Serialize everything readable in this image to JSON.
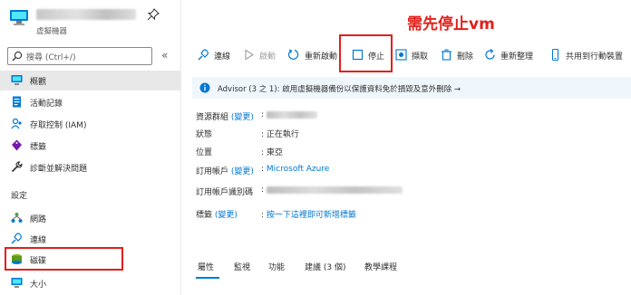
{
  "annotation": "需先停止vm",
  "vm": {
    "subtitle": "虛擬機器"
  },
  "search": {
    "placeholder": "搜尋 (Ctrl+/)"
  },
  "nav": {
    "items": [
      {
        "label": "概觀",
        "icon": "overview-icon"
      },
      {
        "label": "活動記錄",
        "icon": "activity-log-icon"
      },
      {
        "label": "存取控制 (IAM)",
        "icon": "people-icon"
      },
      {
        "label": "標籤",
        "icon": "tag-icon"
      },
      {
        "label": "診斷並解決問題",
        "icon": "wrench-icon"
      }
    ],
    "section_settings": "設定",
    "settings_items": [
      {
        "label": "網路",
        "icon": "network-icon"
      },
      {
        "label": "連線",
        "icon": "connect-icon"
      },
      {
        "label": "磁碟",
        "icon": "disk-icon"
      },
      {
        "label": "大小",
        "icon": "size-icon"
      }
    ]
  },
  "toolbar": {
    "connect": "連線",
    "start": "啟動",
    "restart": "重新啟動",
    "stop": "停止",
    "capture": "擷取",
    "delete": "刪除",
    "refresh": "重新整理",
    "share": "共用到行動裝置"
  },
  "advisor": {
    "text": "Advisor (3 之 1): 啟用虛擬機器備份以保護資料免於損毀及意外刪除 →"
  },
  "properties": {
    "resource_group_label": "資源群組",
    "resource_group_change": "(變更)",
    "status_label": "狀態",
    "status_value": "正在執行",
    "location_label": "位置",
    "location_value": "東亞",
    "subscription_label": "訂用帳戶",
    "subscription_change": "(變更)",
    "subscription_value": "Microsoft Azure",
    "subscription_id_label": "訂用帳戶識別碼",
    "tags_label": "標籤",
    "tags_change": "(變更)",
    "tags_value": "按一下這裡即可新增標籤"
  },
  "tabs": [
    "屬性",
    "監視",
    "功能",
    "建議 (3 個)",
    "教學課程"
  ]
}
